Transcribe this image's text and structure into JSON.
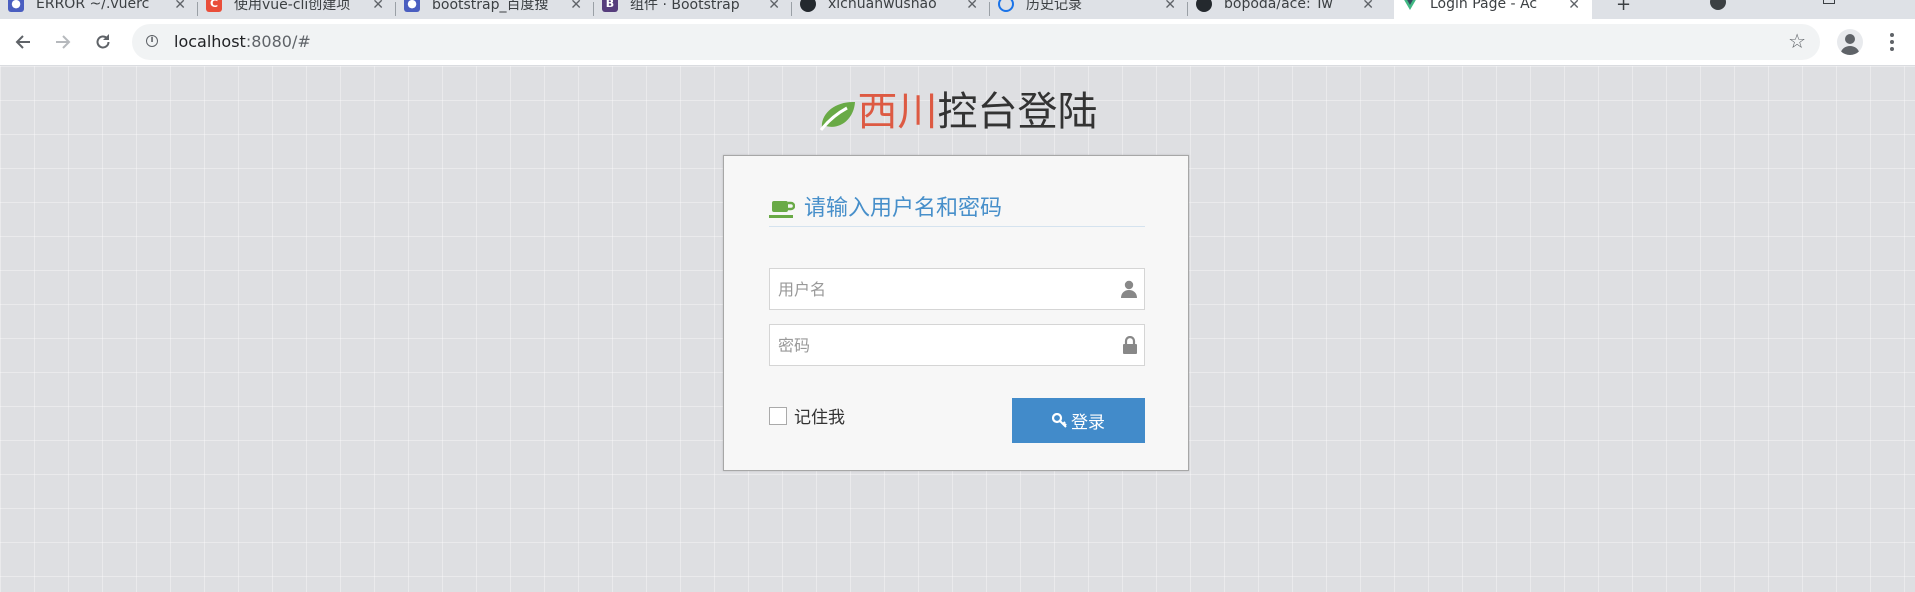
{
  "browser": {
    "tabs": [
      {
        "title": "ERROR ~/.vuerc",
        "favicon_color": "#4a5ec0",
        "favicon": "baidu-icon",
        "active": false
      },
      {
        "title": "使用vue-cli创建项",
        "favicon_color": "#e94e3a",
        "favicon": "csdn-icon",
        "active": false
      },
      {
        "title": "bootstrap_百度搜",
        "favicon_color": "#4a5ec0",
        "favicon": "baidu-icon",
        "active": false
      },
      {
        "title": "组件 · Bootstrap",
        "favicon_color": "#563d7c",
        "favicon": "bootstrap-icon",
        "active": false
      },
      {
        "title": "xichuanwushao",
        "favicon_color": "#24292e",
        "favicon": "github-icon",
        "active": false
      },
      {
        "title": "历史记录",
        "favicon_color": "#1a73e8",
        "favicon": "history-icon",
        "active": false
      },
      {
        "title": "bopoda/ace: Tw",
        "favicon_color": "#24292e",
        "favicon": "github-icon",
        "active": false
      },
      {
        "title": "Login Page - Ac",
        "favicon_color": "#41b883",
        "favicon": "vue-icon",
        "active": true
      }
    ],
    "tab_close_glyph": "✕",
    "new_tab_glyph": "+",
    "url_host": "localhost",
    "url_rest": ":8080/#"
  },
  "page": {
    "brand_red": "西川",
    "brand_dark": "控台登陆",
    "header_text": "请输入用户名和密码",
    "username_placeholder": "用户名",
    "password_placeholder": "密码",
    "remember_label": "记住我",
    "login_label": "登录"
  },
  "colors": {
    "brand_red": "#dd5a43",
    "leaf_green": "#69aa46",
    "header_blue": "#478fca",
    "button_blue": "#428bca"
  }
}
